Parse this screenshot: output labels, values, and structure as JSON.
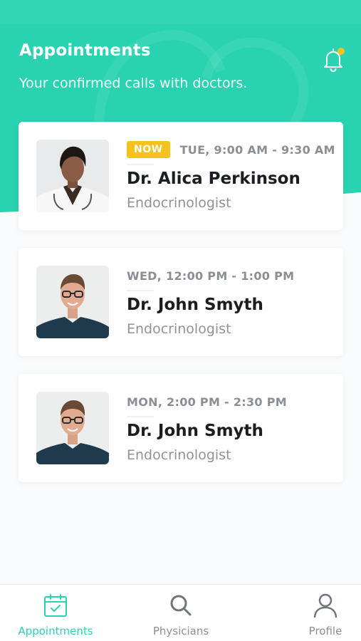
{
  "colors": {
    "accent": "#29d3b1",
    "badge": "#f6c21d",
    "notification_dot": "#f6c21d"
  },
  "header": {
    "title": "Appointments",
    "subtitle": "Your confirmed calls with doctors.",
    "bell_icon": "bell-icon",
    "has_notification": true
  },
  "appointments": [
    {
      "badge": "NOW",
      "time": "TUE, 9:00 AM - 9:30 AM",
      "name": "Dr. Alica Perkinson",
      "specialty": "Endocrinologist",
      "avatar": "female-doctor-photo"
    },
    {
      "badge": "",
      "time": "WED, 12:00 PM - 1:00 PM",
      "name": "Dr. John Smyth",
      "specialty": "Endocrinologist",
      "avatar": "male-doctor-photo"
    },
    {
      "badge": "",
      "time": "MON, 2:00 PM - 2:30 PM",
      "name": "Dr. John Smyth",
      "specialty": "Endocrinologist",
      "avatar": "male-doctor-photo"
    }
  ],
  "tabbar": {
    "items": [
      {
        "label": "Appointments",
        "icon": "calendar-check-icon",
        "active": true
      },
      {
        "label": "Physicians",
        "icon": "search-icon",
        "active": false
      },
      {
        "label": "Profile",
        "icon": "user-icon",
        "active": false
      }
    ]
  }
}
